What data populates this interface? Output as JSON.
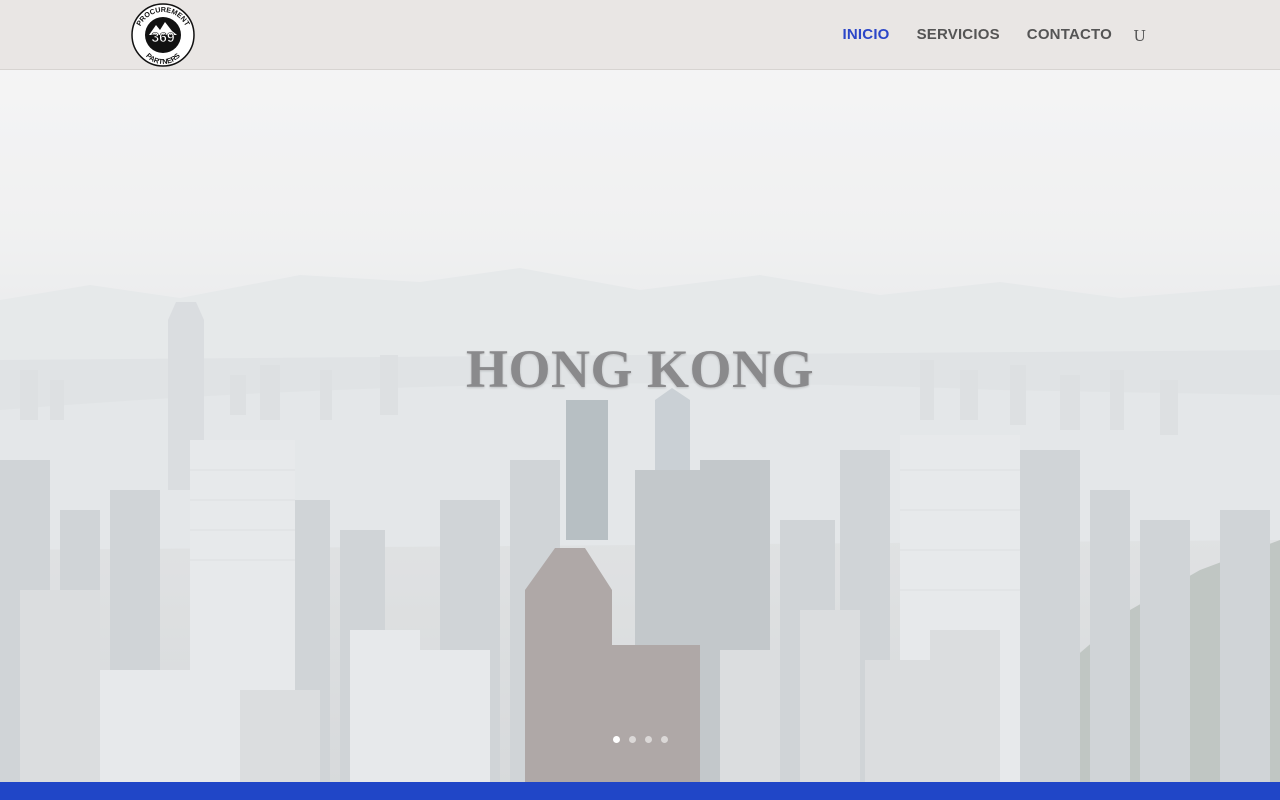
{
  "brand": {
    "logo_number": "369",
    "logo_text_top": "PROCUREMENT",
    "logo_text_bottom": "PARTNERS"
  },
  "nav": {
    "items": [
      {
        "label": "INICIO",
        "active": true
      },
      {
        "label": "SERVICIOS",
        "active": false
      },
      {
        "label": "CONTACTO",
        "active": false
      }
    ],
    "search_icon": "U"
  },
  "hero": {
    "title": "HONG KONG",
    "slides_total": 4,
    "active_slide": 1
  },
  "colors": {
    "accent": "#2b46c8",
    "footer": "#2046c7",
    "header_bg": "#e9e6e4",
    "nav_text": "#555555"
  }
}
